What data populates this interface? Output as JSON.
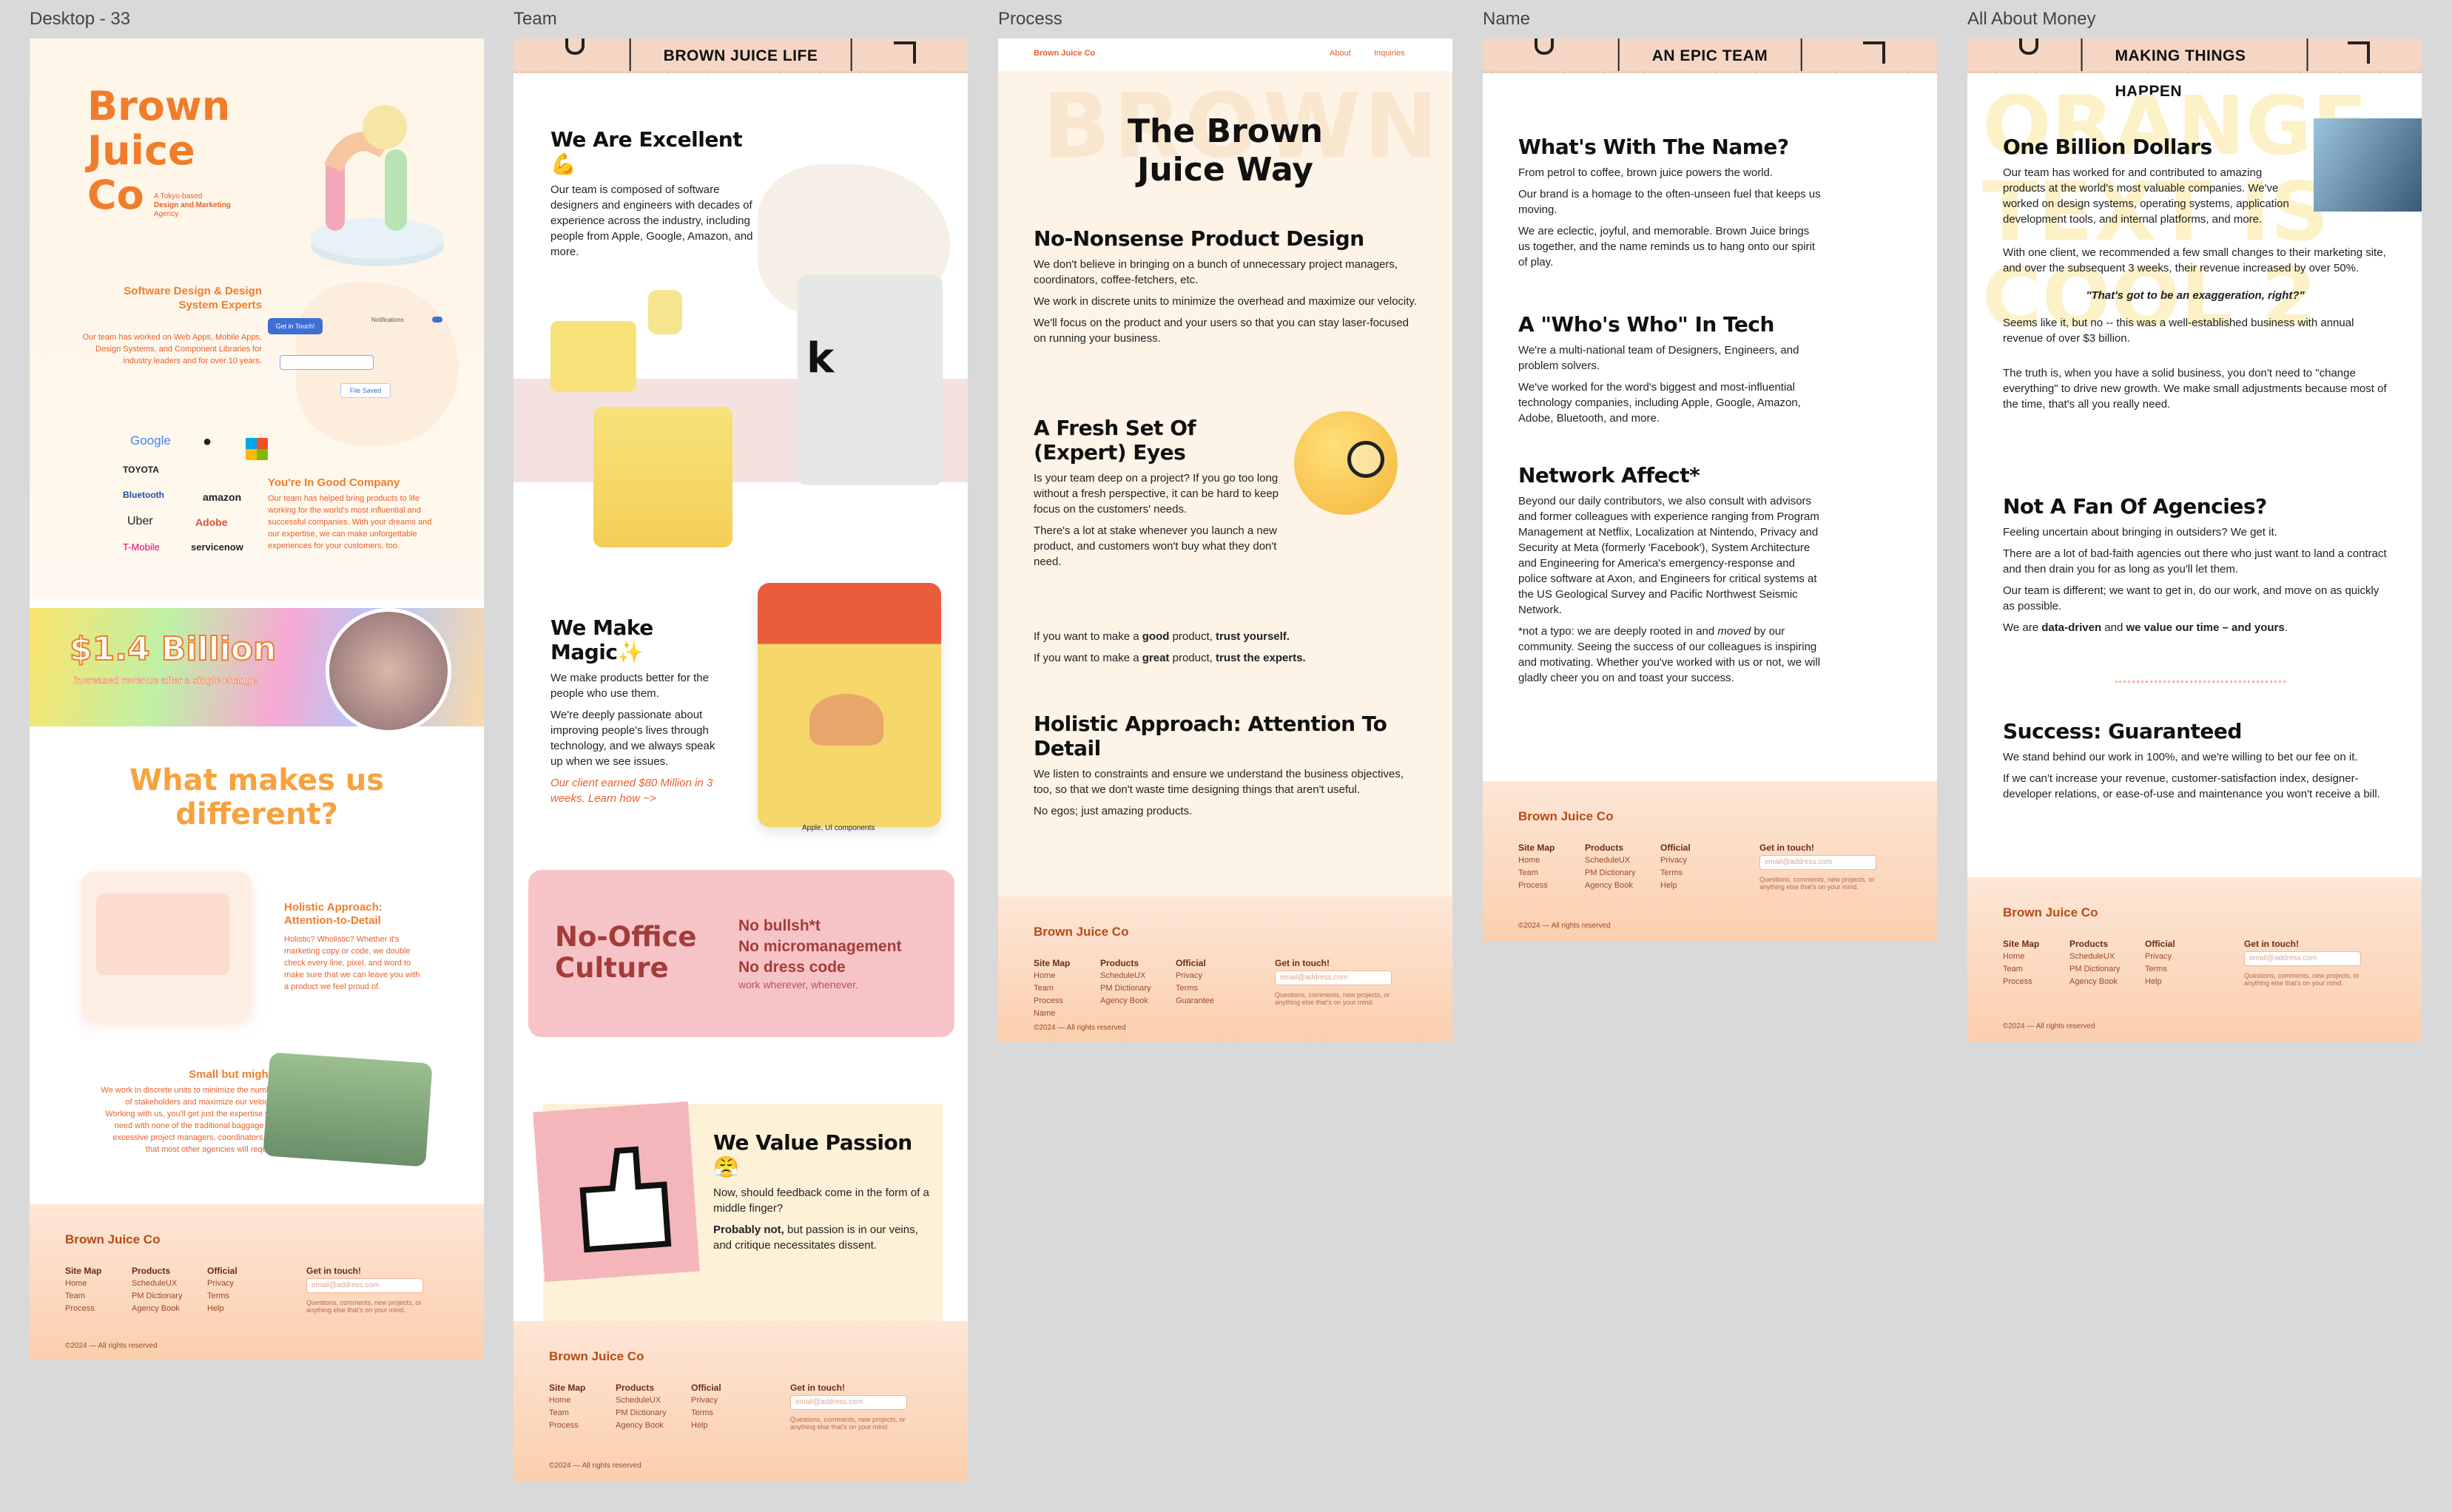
{
  "frames": {
    "desktop": "Desktop - 33",
    "team": "Team",
    "process": "Process",
    "name": "Name",
    "money": "All About Money"
  },
  "desktop": {
    "logo": [
      "Brown",
      "Juice",
      "Co"
    ],
    "tagline": [
      "A Tokyo-based",
      "Design and Marketing",
      "Agency"
    ],
    "services_title": "Software Design & Design System Experts",
    "services_text": "Our team has worked on Web Apps, Mobile Apps, Design Systems, and Component Libraries for industry leaders and for over 10 years.",
    "ui_button": "Get in Touch!",
    "ui_file": "File Saved",
    "ui_notif": "Notifications",
    "logos": [
      "Google",
      "TOYOTA",
      "Bluetooth",
      "Uber",
      "T-Mobile",
      "amazon",
      "Adobe",
      "servicenow",
      "Microsoft"
    ],
    "company_title": "You're In Good Company",
    "company_text": "Our team has helped bring products to life working for the world's most influential and successful companies. With your dreams and our expertise, we can make unforgettable experiences for your customers, too.",
    "billion": "$1.4 Billion",
    "billion_sub": "increased revenue after a single change",
    "diff_title": [
      "What makes us",
      "different?"
    ],
    "holistic_title": [
      "Holistic Approach:",
      "Attention-to-Detail"
    ],
    "holistic_text": "Holistic? Wholistic? Whether it's marketing copy or code, we double check every line, pixel, and word to make sure that we can leave you with a product we feel proud of.",
    "small_title": "Small but mighty",
    "small_text": "We work in discrete units to minimize the number of stakeholders and maximize our velocity. Working with us, you'll get just the expertise you need with none of the traditional baggage like excessive project managers, coordinators, etc that most other agencies will require."
  },
  "footer": {
    "brand": "Brown Juice Co",
    "sitemap": "Site Map",
    "sitemap_items": [
      "Home",
      "Team",
      "Process"
    ],
    "sitemap_items_name": [
      "Home",
      "Team",
      "Process",
      "Name"
    ],
    "products": "Products",
    "products_items": [
      "ScheduleUX",
      "PM Dictionary",
      "Agency Book"
    ],
    "official": "Official",
    "official_items": [
      "Privacy",
      "Terms",
      "Help"
    ],
    "official_items_process": [
      "Privacy",
      "Terms",
      "Guarantee"
    ],
    "contact": "Get in touch!",
    "email_placeholder": "email@address.com",
    "contact_note": "Questions, comments, new projects, or anything else that's on your mind.",
    "copyright": "©2024 — All rights reserved"
  },
  "team": {
    "header": "BROWN JUICE LIFE",
    "excellent_title": "We Are Excellent💪",
    "excellent_text": "Our team is composed of software designers and engineers with decades of experience across the industry, including people from Apple, Google, Amazon, and more.",
    "magic_title": "We Make Magic✨",
    "magic_p1": "We make products better for the people who use them.",
    "magic_p2": "We're deeply passionate about improving people's lives through technology, and we always speak up when we see issues.",
    "magic_link": "Our client earned $80 Million in 3 weeks. Learn how ~>",
    "caption": "Apple, UI components",
    "office_title": [
      "No-Office",
      "Culture"
    ],
    "office_items": [
      "No bullsh*t",
      "No micromanagement",
      "No dress code"
    ],
    "office_sub": "work wherever, whenever.",
    "passion_title": "We Value Passion😤",
    "passion_p1": "Now, should feedback come in the form of a middle finger?",
    "passion_bold": "Probably not,",
    "passion_p2": " but passion is in our veins, and critique necessitates dissent."
  },
  "process": {
    "brand": "Brown Juice Co",
    "nav": [
      "About",
      "Inquiries"
    ],
    "bg_text": "BROWN",
    "title": [
      "The Brown",
      "Juice Way"
    ],
    "s1_title": "No-Nonsense Product Design",
    "s1_p1": "We don't believe in bringing on a bunch of unnecessary project managers, coordinators, coffee-fetchers, etc.",
    "s1_p2": "We work in discrete units to minimize the overhead and maximize our velocity.",
    "s1_p3": "We'll focus on the product and your users so that you can stay laser-focused on running your business.",
    "s2_title": "A Fresh Set Of (Expert) Eyes",
    "s2_p1": "Is your team deep on a project? If you go too long without a fresh perspective, it can be hard to keep focus on the customers' needs.",
    "s2_p2": "There's a lot at stake whenever you launch a new product, and customers won't buy what they don't need.",
    "s2_l1a": "If you want to make a ",
    "s2_l1b": "good",
    "s2_l1c": " product, ",
    "s2_l1d": "trust yourself.",
    "s2_l2a": "If you want to make a ",
    "s2_l2b": "great",
    "s2_l2c": " product, ",
    "s2_l2d": "trust the experts.",
    "s3_title": "Holistic Approach: Attention To Detail",
    "s3_p1": "We listen to constraints and ensure we understand the business objectives, too, so that we don't waste time designing things that aren't useful.",
    "s3_p2": "No egos; just amazing products."
  },
  "name": {
    "header": "AN EPIC TEAM",
    "s1_title": "What's With The Name?",
    "s1_p1": "From petrol to coffee, brown juice powers the world.",
    "s1_p2": "Our brand is a homage to the often-unseen fuel that keeps us moving.",
    "s1_p3": "We are eclectic, joyful, and memorable. Brown Juice brings us together, and the name reminds us to hang onto our spirit of play.",
    "s2_title": "A \"Who's Who\" In Tech",
    "s2_p1": "We're a multi-national team of Designers, Engineers, and problem solvers.",
    "s2_p2": "We've worked for the word's biggest and most-influential technology companies, including Apple, Google, Amazon, Adobe, Bluetooth, and more.",
    "s3_title": "Network Affect*",
    "s3_p1": "Beyond our daily contributors, we also consult with advisors and former colleagues with experience ranging from Program Management at Netflix, Localization at Nintendo, Privacy and Security at Meta (formerly 'Facebook'), System Architecture and Engineering for America's emergency-response and police software at Axon, and Engineers for critical systems at the US Geological Survey and Pacific Northwest Seismic Network.",
    "s3_p2a": "*not a typo: we are deeply rooted in and ",
    "s3_p2b": "moved",
    "s3_p2c": " by our community. Seeing the success of our colleagues is inspiring and motivating. Whether you've worked with us or not, we will gladly cheer you on and toast your success."
  },
  "money": {
    "header": "MAKING THINGS HAPPEN",
    "bg_text": [
      "ORANGE",
      "TEXT IS",
      "COOL 2"
    ],
    "s1_title": "One Billion Dollars",
    "s1_p1": "Our team has worked for and contributed to amazing products at the world's most valuable companies. We've worked on design systems, operating systems, application development tools, and internal platforms, and more.",
    "s1_p2": "With one client, we recommended a few small changes to their marketing site, and over the subsequent 3 weeks, their revenue increased by over 50%.",
    "quote": "\"That's got to be an exaggeration, right?\"",
    "s1_p3": "Seems like it, but no -- this was a well-established business with annual revenue of over $3 billion.",
    "s1_p4": "The truth is, when you have a solid business, you don't need to \"change everything\" to drive new growth. We make small adjustments because most of the time, that's all you really need.",
    "s2_title": "Not A Fan Of Agencies?",
    "s2_p1": "Feeling uncertain about bringing in outsiders? We get it.",
    "s2_p2": "There are a lot of bad-faith agencies out there who just want to land a contract and then drain you for as long as you'll let them.",
    "s2_p3": "Our team is different; we want to get in, do our work, and move on as quickly as possible.",
    "s2_p4a": "We are ",
    "s2_p4b": "data-driven",
    "s2_p4c": " and ",
    "s2_p4d": "we value our time – and yours",
    "s2_p4e": ".",
    "s3_title": "Success: Guaranteed",
    "s3_p1": "We stand behind our work in 100%, and we're willing to bet our fee on it.",
    "s3_p2": "If we can't increase your revenue, customer-satisfaction index, designer-developer relations, or ease-of-use and maintenance you won't receive a bill."
  }
}
